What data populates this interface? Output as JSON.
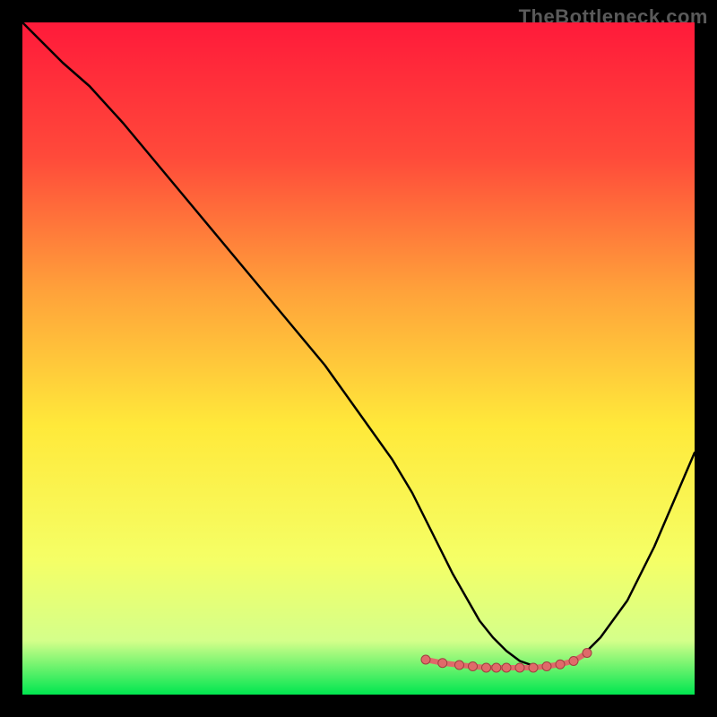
{
  "watermark": "TheBottleneck.com",
  "chart_data": {
    "type": "line",
    "title": "",
    "xlabel": "",
    "ylabel": "",
    "xlim": [
      0,
      100
    ],
    "ylim": [
      0,
      100
    ],
    "gradient_stops": [
      {
        "offset": 0,
        "color": "#ff1a3a"
      },
      {
        "offset": 20,
        "color": "#ff4a3a"
      },
      {
        "offset": 40,
        "color": "#ffa23a"
      },
      {
        "offset": 60,
        "color": "#ffe93a"
      },
      {
        "offset": 80,
        "color": "#f5ff66"
      },
      {
        "offset": 92,
        "color": "#d4ff8a"
      },
      {
        "offset": 100,
        "color": "#00e650"
      }
    ],
    "series": [
      {
        "name": "bottleneck-curve",
        "color": "#000000",
        "width": 2.5,
        "x": [
          0,
          3,
          6,
          10,
          15,
          20,
          25,
          30,
          35,
          40,
          45,
          50,
          55,
          58,
          60,
          62,
          64,
          66,
          68,
          70,
          72,
          74,
          76,
          78,
          80,
          83,
          86,
          90,
          94,
          97,
          100
        ],
        "y": [
          100,
          97,
          94,
          90.5,
          85,
          79,
          73,
          67,
          61,
          55,
          49,
          42,
          35,
          30,
          26,
          22,
          18,
          14.5,
          11,
          8.5,
          6.5,
          5,
          4.3,
          4.1,
          4.3,
          5.5,
          8.5,
          14,
          22,
          29,
          36
        ]
      }
    ],
    "markers": {
      "color": "#e06a6a",
      "radius": 5,
      "stroke": "#a04040",
      "x": [
        60,
        62.5,
        65,
        67,
        69,
        70.5,
        72,
        74,
        76,
        78,
        80,
        82,
        84
      ],
      "y": [
        5.2,
        4.7,
        4.4,
        4.2,
        4.0,
        4.0,
        4.0,
        4.0,
        4.0,
        4.2,
        4.5,
        5.0,
        6.2
      ]
    }
  }
}
